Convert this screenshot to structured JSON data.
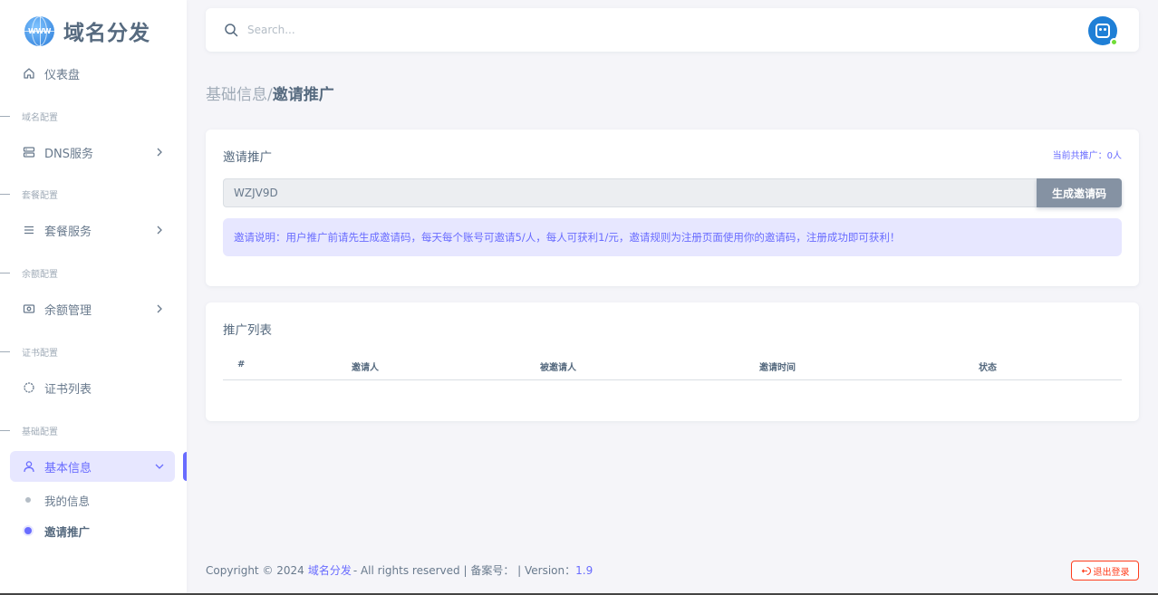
{
  "brand": {
    "name": "域名分发",
    "logo_text": "WWW"
  },
  "sidebar": {
    "dashboard": "仪表盘",
    "sections": {
      "domain": "域名配置",
      "package": "套餐配置",
      "balance": "余额配置",
      "cert": "证书配置",
      "basic": "基础配置"
    },
    "items": {
      "dns": "DNS服务",
      "package": "套餐服务",
      "balance": "余额管理",
      "cert_list": "证书列表",
      "basic_info": "基本信息"
    },
    "sub_items": {
      "my_info": "我的信息",
      "invite": "邀请推广"
    }
  },
  "navbar": {
    "search_placeholder": "Search..."
  },
  "breadcrumb": {
    "parent": "基础信息/",
    "current": "邀请推广"
  },
  "invite_card": {
    "title": "邀请推广",
    "meta": "当前共推广：0人",
    "code": "WZJV9D",
    "generate_label": "生成邀请码",
    "notice": "邀请说明：用户推广前请先生成邀请码，每天每个账号可邀请5/人，每人可获利1/元，邀请规则为注册页面使用你的邀请码，注册成功即可获利！"
  },
  "list_card": {
    "title": "推广列表",
    "columns": [
      "#",
      "邀请人",
      "被邀请人",
      "邀请时间",
      "状态"
    ],
    "rows": []
  },
  "footer": {
    "copyright": "Copyright © 2024",
    "brand_link": "域名分发",
    "rights": "- All rights reserved | 备案号： | Version：",
    "version": "1.9",
    "logout": "退出登录"
  },
  "colors": {
    "accent": "#696cff",
    "danger": "#ff3e1d",
    "secondary": "#8592a3"
  }
}
